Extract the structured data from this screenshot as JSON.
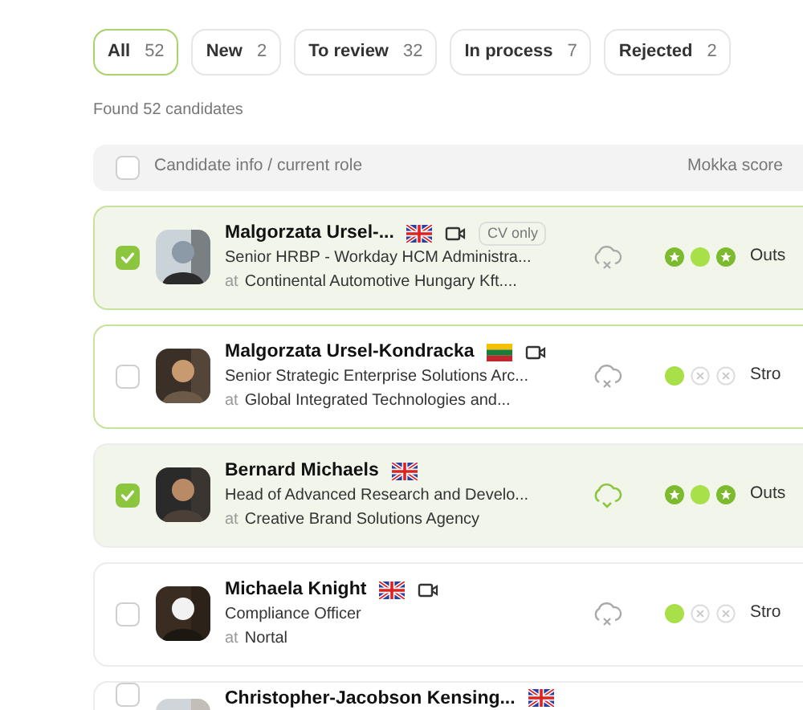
{
  "filter_tabs": [
    {
      "label": "All",
      "count": "52",
      "selected": true
    },
    {
      "label": "New",
      "count": "2",
      "selected": false
    },
    {
      "label": "To review",
      "count": "32",
      "selected": false
    },
    {
      "label": "In process",
      "count": "7",
      "selected": false
    },
    {
      "label": "Rejected",
      "count": "2",
      "selected": false
    }
  ],
  "result_count": "Found 52 candidates",
  "table": {
    "columns": [
      "Candidate info / current role",
      "Mokka score"
    ],
    "select_all_checked": false
  },
  "candidates": [
    {
      "name": "Malgorzata Ursel-...",
      "flag": {
        "kind": "uk"
      },
      "video": true,
      "tag": "CV only",
      "role": "Senior HRBP - Workday HCM Administra...",
      "at": "at",
      "company": "Continental Automotive Hungary Kft....",
      "checked": true,
      "highlighted": true,
      "cv_synced": false,
      "score_marks": [
        {
          "kind": "star"
        },
        {
          "kind": "dot"
        },
        {
          "kind": "star"
        }
      ],
      "score_label": "Outs"
    },
    {
      "name": "Malgorzata Ursel-Kondracka",
      "flag": {
        "kind": "lt"
      },
      "video": true,
      "role": "Senior Strategic Enterprise Solutions Arc...",
      "at": "at",
      "company": "Global Integrated Technologies and...",
      "checked": false,
      "highlighted": true,
      "cv_synced": false,
      "score_marks": [
        {
          "kind": "dot"
        },
        {
          "kind": "cross"
        },
        {
          "kind": "cross"
        }
      ],
      "score_label": "Stro"
    },
    {
      "name": "Bernard Michaels",
      "flag": {
        "kind": "uk"
      },
      "video": false,
      "role": "Head of Advanced Research and Develo...",
      "at": "at",
      "company": "Creative Brand Solutions Agency",
      "checked": true,
      "highlighted": false,
      "cv_synced": true,
      "score_marks": [
        {
          "kind": "star"
        },
        {
          "kind": "dot"
        },
        {
          "kind": "star"
        }
      ],
      "score_label": "Outs"
    },
    {
      "name": "Michaela Knight",
      "flag": {
        "kind": "uk"
      },
      "video": true,
      "role": "Compliance Officer",
      "at": "at",
      "company": "Nortal",
      "checked": false,
      "highlighted": false,
      "cv_synced": false,
      "score_marks": [
        {
          "kind": "dot"
        },
        {
          "kind": "cross"
        },
        {
          "kind": "cross"
        }
      ],
      "score_label": "Stro"
    },
    {
      "name": "Christopher-Jacobson Kensing...",
      "flag": {
        "kind": "uk"
      },
      "video": false,
      "checked": false,
      "highlighted": false
    }
  ]
}
